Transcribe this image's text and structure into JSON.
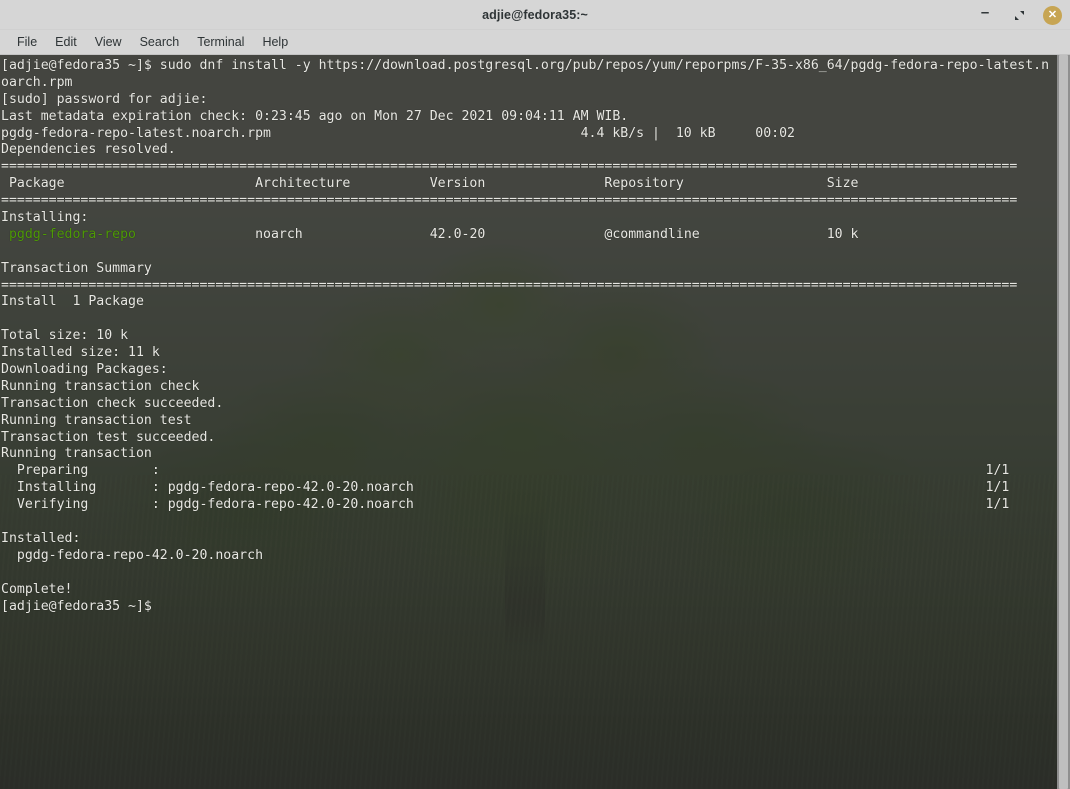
{
  "window": {
    "title": "adjie@fedora35:~",
    "controls": {
      "minimize_label": "–",
      "maximize_label": "maximize-restore",
      "close_label": "✕"
    }
  },
  "menubar": {
    "items": [
      {
        "label": "File",
        "name": "menu-file"
      },
      {
        "label": "Edit",
        "name": "menu-edit"
      },
      {
        "label": "View",
        "name": "menu-view"
      },
      {
        "label": "Search",
        "name": "menu-search"
      },
      {
        "label": "Terminal",
        "name": "menu-terminal"
      },
      {
        "label": "Help",
        "name": "menu-help"
      }
    ]
  },
  "colors": {
    "titlebar_bg": "#d6d6d6",
    "close_button": "#c7a553",
    "terminal_fg": "#e8e8e3",
    "package_green": "#4e9a06",
    "scrollbar_thumb": "#bfbfbf"
  },
  "terminal": {
    "prompt": "[adjie@fedora35 ~]$",
    "command": "sudo dnf install -y https://download.postgresql.org/pub/repos/yum/reporpms/F-35-x86_64/pgdg-fedora-repo-latest.noarch.rpm",
    "lines": [
      {
        "id": "l01",
        "text": "[adjie@fedora35 ~]$ sudo dnf install -y https://download.postgresql.org/pub/repos/yum/reporpms/F-35-x86_64/pgdg-fedora-repo-latest.n"
      },
      {
        "id": "l02",
        "text": "oarch.rpm"
      },
      {
        "id": "l03",
        "text": "[sudo] password for adjie:"
      },
      {
        "id": "l04",
        "text": "Last metadata expiration check: 0:23:45 ago on Mon 27 Dec 2021 09:04:11 AM WIB."
      },
      {
        "id": "l05",
        "text": "pgdg-fedora-repo-latest.noarch.rpm                                       4.4 kB/s |  10 kB     00:02"
      },
      {
        "id": "l06",
        "text": "Dependencies resolved."
      },
      {
        "id": "l07",
        "text": "================================================================================================================================"
      },
      {
        "id": "l08",
        "text": " Package                        Architecture          Version               Repository                  Size"
      },
      {
        "id": "l09",
        "text": "================================================================================================================================"
      },
      {
        "id": "l10",
        "text": "Installing:"
      },
      {
        "id": "l11",
        "text": " pgdg-fedora-repo",
        "green": true,
        "suffix": "               noarch                42.0-20               @commandline                10 k"
      },
      {
        "id": "l12",
        "text": ""
      },
      {
        "id": "l13",
        "text": "Transaction Summary"
      },
      {
        "id": "l14",
        "text": "================================================================================================================================"
      },
      {
        "id": "l15",
        "text": "Install  1 Package"
      },
      {
        "id": "l16",
        "text": ""
      },
      {
        "id": "l17",
        "text": "Total size: 10 k"
      },
      {
        "id": "l18",
        "text": "Installed size: 11 k"
      },
      {
        "id": "l19",
        "text": "Downloading Packages:"
      },
      {
        "id": "l20",
        "text": "Running transaction check"
      },
      {
        "id": "l21",
        "text": "Transaction check succeeded."
      },
      {
        "id": "l22",
        "text": "Running transaction test"
      },
      {
        "id": "l23",
        "text": "Transaction test succeeded."
      },
      {
        "id": "l24",
        "text": "Running transaction"
      },
      {
        "id": "l25",
        "text": "  Preparing        :                                                                                                        1/1"
      },
      {
        "id": "l26",
        "text": "  Installing       : pgdg-fedora-repo-42.0-20.noarch                                                                        1/1"
      },
      {
        "id": "l27",
        "text": "  Verifying        : pgdg-fedora-repo-42.0-20.noarch                                                                        1/1"
      },
      {
        "id": "l28",
        "text": ""
      },
      {
        "id": "l29",
        "text": "Installed:"
      },
      {
        "id": "l30",
        "text": "  pgdg-fedora-repo-42.0-20.noarch"
      },
      {
        "id": "l31",
        "text": ""
      },
      {
        "id": "l32",
        "text": "Complete!"
      },
      {
        "id": "l33",
        "text": "[adjie@fedora35 ~]$"
      }
    ],
    "package_table": {
      "headers": [
        "Package",
        "Architecture",
        "Version",
        "Repository",
        "Size"
      ],
      "section_label": "Installing:",
      "rows": [
        {
          "package": "pgdg-fedora-repo",
          "architecture": "noarch",
          "version": "42.0-20",
          "repository": "@commandline",
          "size": "10 k"
        }
      ]
    },
    "download_progress": {
      "file": "pgdg-fedora-repo-latest.noarch.rpm",
      "rate": "4.4 kB/s",
      "size": "10 kB",
      "time": "00:02"
    },
    "transaction_summary": {
      "heading": "Transaction Summary",
      "install_line": "Install  1 Package",
      "total_size": "Total size: 10 k",
      "installed_size": "Installed size: 11 k"
    },
    "steps": [
      {
        "label": "Preparing",
        "target": "",
        "counter": "1/1"
      },
      {
        "label": "Installing",
        "target": "pgdg-fedora-repo-42.0-20.noarch",
        "counter": "1/1"
      },
      {
        "label": "Verifying",
        "target": "pgdg-fedora-repo-42.0-20.noarch",
        "counter": "1/1"
      }
    ],
    "installed_heading": "Installed:",
    "installed_package": "pgdg-fedora-repo-42.0-20.noarch",
    "complete": "Complete!",
    "metadata_check": "Last metadata expiration check: 0:23:45 ago on Mon 27 Dec 2021 09:04:11 AM WIB.",
    "sudo_prompt": "[sudo] password for adjie:",
    "dependencies": "Dependencies resolved."
  }
}
